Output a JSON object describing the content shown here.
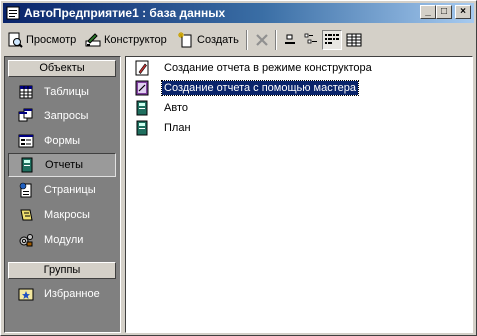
{
  "window": {
    "title": "АвтоПредприятие1 : база данных",
    "controls": {
      "minimize": "_",
      "maximize": "□",
      "close": "×"
    }
  },
  "toolbar": {
    "preview_label": "Просмотр",
    "design_label": "Конструктор",
    "create_label": "Создать",
    "icons": [
      "preview-icon",
      "design-icon",
      "create-icon",
      "delete-icon",
      "large-icons-icon",
      "small-icons-icon",
      "list-view-icon",
      "details-view-icon"
    ]
  },
  "sidebar": {
    "objects_header": "Объекты",
    "groups_header": "Группы",
    "items": [
      {
        "label": "Таблицы",
        "icon": "table-icon"
      },
      {
        "label": "Запросы",
        "icon": "query-icon"
      },
      {
        "label": "Формы",
        "icon": "form-icon"
      },
      {
        "label": "Отчеты",
        "icon": "report-icon",
        "active": true
      },
      {
        "label": "Страницы",
        "icon": "page-icon"
      },
      {
        "label": "Макросы",
        "icon": "macro-icon"
      },
      {
        "label": "Модули",
        "icon": "module-icon"
      }
    ],
    "groups": [
      {
        "label": "Избранное",
        "icon": "favorites-icon"
      }
    ]
  },
  "list": {
    "items": [
      {
        "label": "Создание отчета в режиме конструктора",
        "icon": "design-report-icon"
      },
      {
        "label": "Создание отчета с помощью мастера",
        "icon": "wizard-report-icon",
        "selected": true
      },
      {
        "label": "Авто",
        "icon": "report-icon"
      },
      {
        "label": "План",
        "icon": "report-icon"
      }
    ]
  },
  "colors": {
    "titlebar_start": "#0a246a",
    "titlebar_end": "#a6caf0",
    "face": "#d4d0c8",
    "sidebar_bg": "#808080",
    "selection": "#0a246a"
  }
}
